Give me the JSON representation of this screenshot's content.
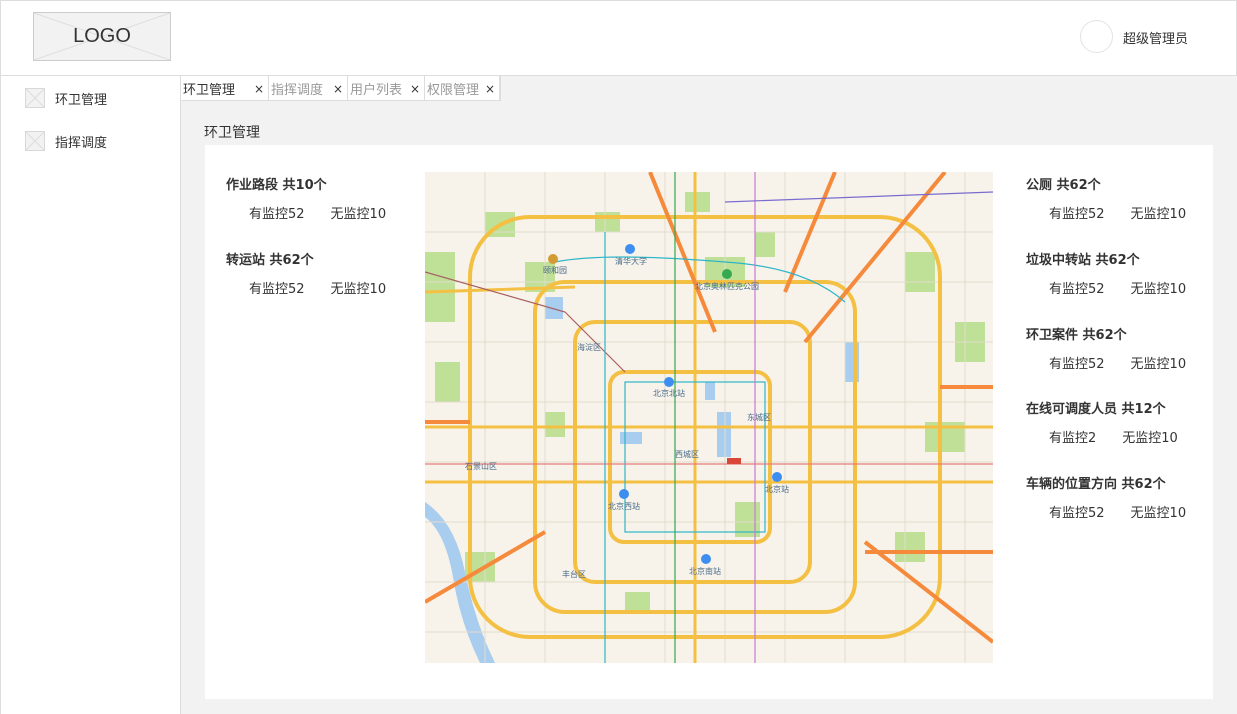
{
  "header": {
    "logo_text": "LOGO",
    "user_name": "超级管理员"
  },
  "sidebar": {
    "items": [
      {
        "label": "环卫管理"
      },
      {
        "label": "指挥调度"
      }
    ]
  },
  "tabs": [
    {
      "label": "环卫管理",
      "active": true
    },
    {
      "label": "指挥调度",
      "active": false
    },
    {
      "label": "用户列表",
      "active": false
    },
    {
      "label": "权限管理",
      "active": false
    }
  ],
  "tab_close_glyph": "×",
  "page_title": "环卫管理",
  "left_stats": [
    {
      "title": "作业路段 共10个",
      "monitored": "有监控52",
      "unmonitored": "无监控10"
    },
    {
      "title": "转运站 共62个",
      "monitored": "有监控52",
      "unmonitored": "无监控10"
    }
  ],
  "right_stats": [
    {
      "title": "公厕 共62个",
      "monitored": "有监控52",
      "unmonitored": "无监控10"
    },
    {
      "title": "垃圾中转站 共62个",
      "monitored": "有监控52",
      "unmonitored": "无监控10"
    },
    {
      "title": "环卫案件 共62个",
      "monitored": "有监控52",
      "unmonitored": "无监控10"
    },
    {
      "title": "在线可调度人员 共12个",
      "monitored": "有监控2",
      "unmonitored": "无监控10"
    },
    {
      "title": "车辆的位置方向 共62个",
      "monitored": "有监控52",
      "unmonitored": "无监控10"
    }
  ],
  "map": {
    "labels": [
      "清华大学",
      "颐和园",
      "北京奥林匹克公园",
      "海淀区",
      "北京北站",
      "东城区",
      "西城区",
      "北京站",
      "石景山区",
      "北京西站",
      "丰台区",
      "北京南站"
    ],
    "colors": {
      "ring_road": "#f4c043",
      "expressway": "#f58a3c",
      "park": "#b9de8f",
      "water": "#a8cdee"
    }
  }
}
